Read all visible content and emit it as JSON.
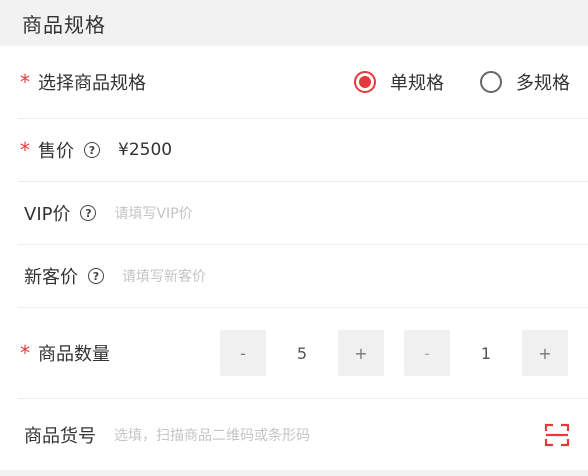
{
  "section": {
    "title": "商品规格"
  },
  "spec": {
    "label": "选择商品规格",
    "options": [
      {
        "label": "单规格",
        "selected": true
      },
      {
        "label": "多规格",
        "selected": false
      }
    ]
  },
  "price": {
    "label": "售价",
    "value": "¥2500"
  },
  "vip_price": {
    "label": "VIP价",
    "placeholder": "请填写VIP价"
  },
  "new_price": {
    "label": "新客价",
    "placeholder": "请填写新客价"
  },
  "quantity": {
    "label": "商品数量",
    "stepper1": {
      "minus": "-",
      "value": "5",
      "plus": "+"
    },
    "stepper2": {
      "minus": "-",
      "value": "1",
      "plus": "+"
    }
  },
  "sku": {
    "label": "商品货号",
    "placeholder": "选填，扫描商品二维码或条形码"
  },
  "symbols": {
    "required": "*",
    "help": "?"
  },
  "colors": {
    "accent": "#e23b3b",
    "placeholder": "#c4c4c4"
  },
  "icons": {
    "help": "question-circle-icon",
    "scan": "scan-icon"
  }
}
